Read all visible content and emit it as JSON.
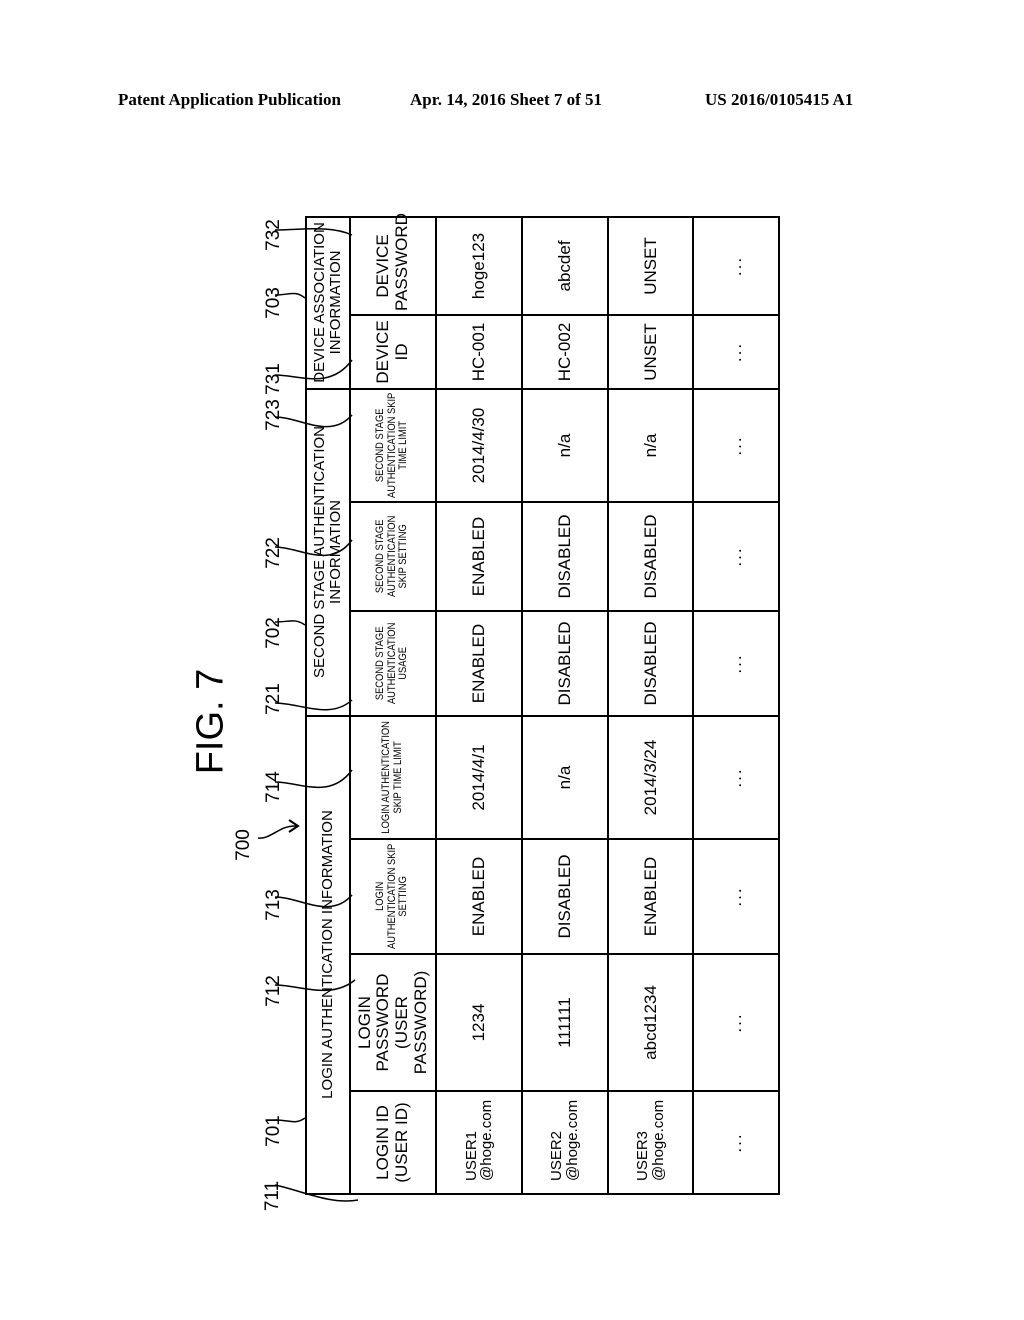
{
  "header": {
    "publication": "Patent Application Publication",
    "date_sheet": "Apr. 14, 2016  Sheet 7 of 51",
    "number": "US 2016/0105415 A1"
  },
  "figure": {
    "title": "FIG. 7",
    "table_ref": "700"
  },
  "groups": [
    {
      "ref": "701",
      "label": "LOGIN AUTHENTICATION INFORMATION"
    },
    {
      "ref": "702",
      "label": "SECOND STAGE AUTHENTICATION INFORMATION"
    },
    {
      "ref": "703",
      "label": "DEVICE ASSOCIATION INFORMATION"
    }
  ],
  "columns": [
    {
      "ref": "711",
      "label": "LOGIN ID (USER ID)"
    },
    {
      "ref": "712",
      "label": "LOGIN PASSWORD (USER PASSWORD)"
    },
    {
      "ref": "713",
      "label": "LOGIN AUTHENTICATION SKIP SETTING"
    },
    {
      "ref": "714",
      "label": "LOGIN AUTHENTICATION SKIP TIME LIMIT"
    },
    {
      "ref": "721",
      "label": "SECOND STAGE AUTHENTICATION USAGE"
    },
    {
      "ref": "722",
      "label": "SECOND STAGE AUTHENTICATION SKIP SETTING"
    },
    {
      "ref": "723",
      "label": "SECOND STAGE AUTHENTICATION SKIP TIME LIMIT"
    },
    {
      "ref": "731",
      "label": "DEVICE ID"
    },
    {
      "ref": "732",
      "label": "DEVICE PASSWORD"
    }
  ],
  "rows": [
    [
      "USER1 @hoge.com",
      "1234",
      "ENABLED",
      "2014/4/1",
      "ENABLED",
      "ENABLED",
      "2014/4/30",
      "HC-001",
      "hoge123"
    ],
    [
      "USER2 @hoge.com",
      "111111",
      "DISABLED",
      "n/a",
      "DISABLED",
      "DISABLED",
      "n/a",
      "HC-002",
      "abcdef"
    ],
    [
      "USER3 @hoge.com",
      "abcd1234",
      "ENABLED",
      "2014/3/24",
      "DISABLED",
      "DISABLED",
      "n/a",
      "UNSET",
      "UNSET"
    ],
    [
      "...",
      "...",
      "...",
      "...",
      "...",
      "...",
      "...",
      "...",
      "..."
    ]
  ]
}
